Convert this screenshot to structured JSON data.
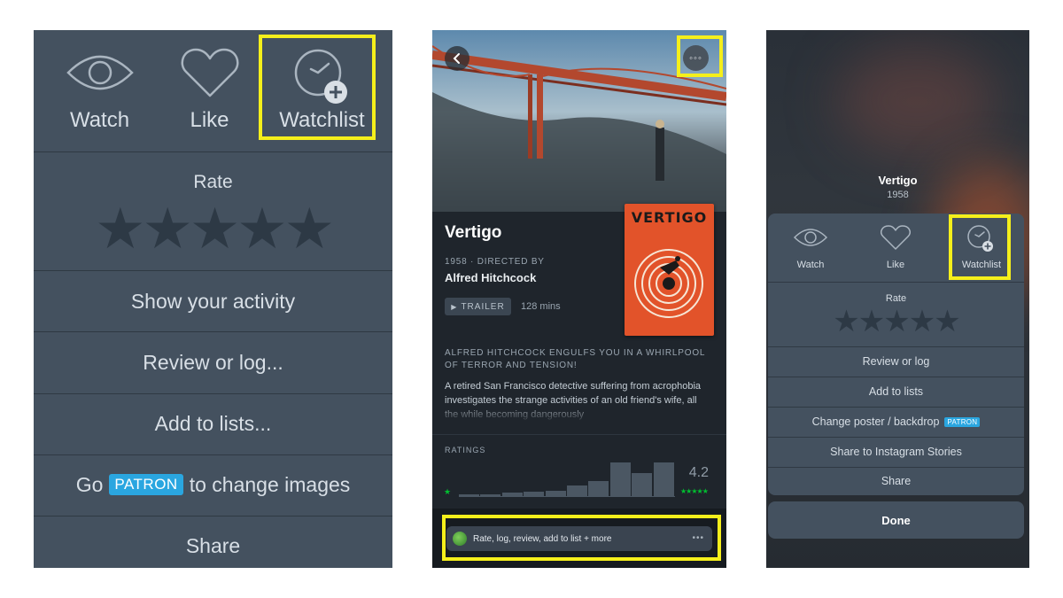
{
  "panel1": {
    "actions": [
      {
        "label": "Watch",
        "icon": "eye-icon"
      },
      {
        "label": "Like",
        "icon": "heart-icon"
      },
      {
        "label": "Watchlist",
        "icon": "clock-plus-icon"
      }
    ],
    "rate_label": "Rate",
    "rating_stars": 5,
    "rows": {
      "show_activity": "Show your activity",
      "review_or_log": "Review or log...",
      "add_to_lists": "Add to lists...",
      "go_prefix": "Go",
      "patron_badge": "PATRON",
      "change_images_suffix": "to change images",
      "share": "Share"
    }
  },
  "panel2": {
    "title": "Vertigo",
    "meta": "1958 · DIRECTED BY",
    "director": "Alfred Hitchcock",
    "trailer_label": "TRAILER",
    "runtime": "128 mins",
    "poster_title": "VERTIGO",
    "tagline": "ALFRED HITCHCOCK ENGULFS YOU IN A WHIRLPOOL OF TERROR AND TENSION!",
    "synopsis": "A retired San Francisco detective suffering from acrophobia investigates the strange activities of an old friend's wife, all the while becoming dangerously",
    "ratings_label": "RATINGS",
    "rating_min_star": "★",
    "rating_max_stars": "★★★★★",
    "average_rating": "4.2",
    "rating_distribution": [
      0.02,
      0.02,
      0.03,
      0.04,
      0.05,
      0.1,
      0.14,
      0.32,
      0.22,
      0.32
    ],
    "action_bar_text": "Rate, log, review, add to list + more",
    "action_bar_more": "•••",
    "more_button": "◦◦◦"
  },
  "panel3": {
    "title": "Vertigo",
    "year": "1958",
    "actions": [
      {
        "label": "Watch",
        "icon": "eye-icon"
      },
      {
        "label": "Like",
        "icon": "heart-icon"
      },
      {
        "label": "Watchlist",
        "icon": "clock-plus-icon"
      }
    ],
    "rate_label": "Rate",
    "rating_stars": 5,
    "rows": {
      "review_or_log": "Review or log",
      "add_to_lists": "Add to lists",
      "change_poster": "Change poster / backdrop",
      "patron_badge": "PATRON",
      "share_instagram": "Share to Instagram Stories",
      "share": "Share"
    },
    "done_label": "Done"
  },
  "colors": {
    "sheet_bg": "#44515f",
    "highlight": "#f5ef1b",
    "patron": "#2aa6e0",
    "star_green": "#00c030"
  }
}
